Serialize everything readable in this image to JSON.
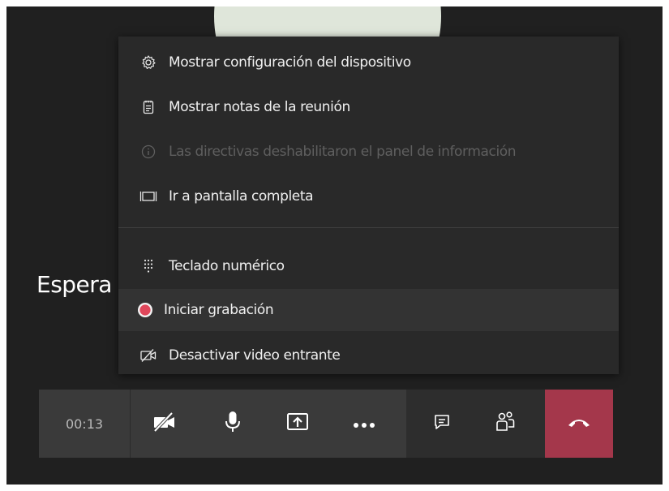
{
  "meeting": {
    "waiting_text": "Espera",
    "timer": "00:13"
  },
  "menu": {
    "items": [
      {
        "label": "Mostrar configuración del dispositivo",
        "icon": "gear-icon",
        "enabled": true
      },
      {
        "label": "Mostrar notas de la reunión",
        "icon": "notes-icon",
        "enabled": true
      },
      {
        "label": "Las directivas deshabilitaron el panel de información",
        "icon": "info-icon",
        "enabled": false
      },
      {
        "label": "Ir a pantalla completa",
        "icon": "fullscreen-icon",
        "enabled": true
      },
      {
        "label": "Teclado numérico",
        "icon": "dialpad-icon",
        "enabled": true
      },
      {
        "label": "Iniciar grabación",
        "icon": "record-icon",
        "enabled": true,
        "highlighted": true
      },
      {
        "label": "Desactivar video entrante",
        "icon": "video-off-icon",
        "enabled": true
      }
    ]
  },
  "toolbar": {
    "buttons": [
      "camera-off-icon",
      "microphone-icon",
      "share-screen-icon",
      "more-options-icon",
      "chat-icon",
      "participants-icon",
      "hang-up-icon"
    ]
  },
  "colors": {
    "background": "#202020",
    "menu": "#292929",
    "toolbar": "#3a3a3a",
    "hang_up": "#a4374b",
    "record": "#e0475b"
  }
}
